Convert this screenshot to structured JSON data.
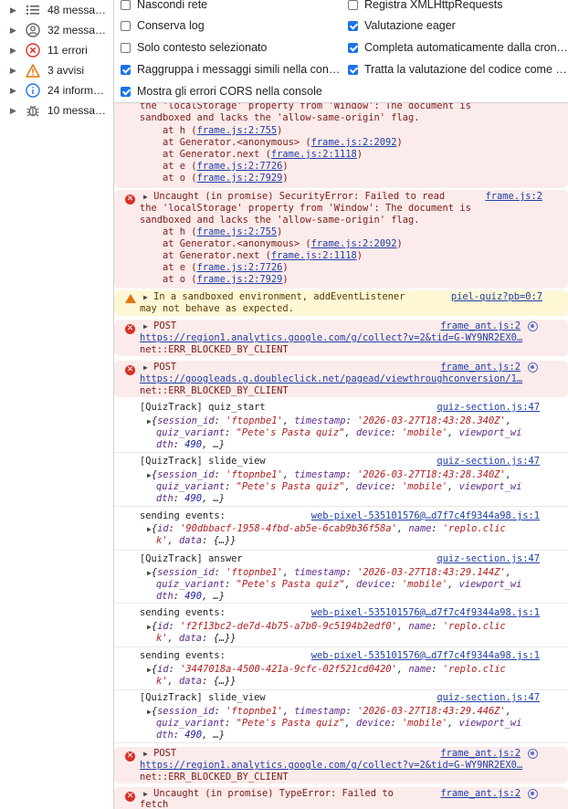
{
  "sidebar": {
    "items": [
      {
        "label": "48 messa…",
        "icon": "list-icon"
      },
      {
        "label": "32 messa…",
        "icon": "user-circle-icon"
      },
      {
        "label": "11 errori",
        "icon": "error-circle-icon"
      },
      {
        "label": "3 avvisi",
        "icon": "warning-triangle-icon"
      },
      {
        "label": "24 inform…",
        "icon": "info-circle-icon"
      },
      {
        "label": "10 messa…",
        "icon": "bug-icon"
      }
    ]
  },
  "settings": {
    "left": [
      {
        "label": "Nascondi rete",
        "checked": false
      },
      {
        "label": "Conserva log",
        "checked": false
      },
      {
        "label": "Solo contesto selezionato",
        "checked": false
      },
      {
        "label": "Raggruppa i messaggi simili nella con…",
        "checked": true
      },
      {
        "label": "Mostra gli errori CORS nella console",
        "checked": true
      }
    ],
    "right": [
      {
        "label": "Registra XMLHttpRequests",
        "checked": false
      },
      {
        "label": "Valutazione eager",
        "checked": true
      },
      {
        "label": "Completa automaticamente dalla cron…",
        "checked": true
      },
      {
        "label": "Tratta la valutazione del codice come …",
        "checked": true
      }
    ]
  },
  "console": {
    "e1": {
      "l1": "the 'localStorage' property from 'Window': The document is",
      "l2": "sandboxed and lacks the 'allow-same-origin' flag.",
      "stack": [
        {
          "pre": "    at h (",
          "link": "frame.js:2:755",
          "post": ")"
        },
        {
          "pre": "    at Generator.<anonymous> (",
          "link": "frame.js:2:2092",
          "post": ")"
        },
        {
          "pre": "    at Generator.next (",
          "link": "frame.js:2:1118",
          "post": ")"
        },
        {
          "pre": "    at e (",
          "link": "frame.js:2:7726",
          "post": ")"
        },
        {
          "pre": "    at o (",
          "link": "frame.js:2:7929",
          "post": ")"
        }
      ]
    },
    "e2": {
      "head": "Uncaught (in promise) SecurityError: Failed to read",
      "source": "frame.js:2",
      "l1": "the 'localStorage' property from 'Window': The document is",
      "l2": "sandboxed and lacks the 'allow-same-origin' flag.",
      "stack": [
        {
          "pre": "    at h (",
          "link": "frame.js:2:755",
          "post": ")"
        },
        {
          "pre": "    at Generator.<anonymous> (",
          "link": "frame.js:2:2092",
          "post": ")"
        },
        {
          "pre": "    at Generator.next (",
          "link": "frame.js:2:1118",
          "post": ")"
        },
        {
          "pre": "    at e (",
          "link": "frame.js:2:7726",
          "post": ")"
        },
        {
          "pre": "    at o (",
          "link": "frame.js:2:7929",
          "post": ")"
        }
      ]
    },
    "w1": {
      "head": "In a sandboxed environment, addEventListener",
      "source": "piel-quiz?pb=0:7",
      "l2": "may not behave as expected."
    },
    "p1": {
      "head": "POST",
      "source": "frame_ant.js:2",
      "url": "https://region1.analytics.google.com/g/collect?v=2&tid=G-WY9NR2EX0…",
      "err": "net::ERR_BLOCKED_BY_CLIENT"
    },
    "p2": {
      "head": "POST",
      "source": "frame_ant.js:2",
      "url": "https://googleads.g.doubleclick.net/pagead/viewthroughconversion/1…",
      "err": "net::ERR_BLOCKED_BY_CLIENT"
    },
    "q1": {
      "head": "[QuizTrack] quiz_start",
      "source": "quiz-section.js:47",
      "sid": "'ftopnbe1'",
      "ts": "'2026-03-27T18:43:28.340Z'",
      "variant": "\"Pete's Pasta quiz\"",
      "device": "'mobile'",
      "vw_a": "viewport_wi",
      "vw_b": "dth",
      "w": "490"
    },
    "q2": {
      "head": "[QuizTrack] slide_view",
      "source": "quiz-section.js:47",
      "sid": "'ftopnbe1'",
      "ts": "'2026-03-27T18:43:28.340Z'",
      "variant": "\"Pete's Pasta quiz\"",
      "device": "'mobile'",
      "vw_a": "viewport_wi",
      "vw_b": "dth",
      "w": "490"
    },
    "s1": {
      "head": "sending events:",
      "source": "web-pixel-535101576@…d7f7c4f9344a98.js:1",
      "id": "'90dbbacf-1958-4fbd-ab5e-6cab9b36f58a'",
      "name_a": "'replo.clic",
      "name_b": "k'"
    },
    "q3": {
      "head": "[QuizTrack] answer",
      "source": "quiz-section.js:47",
      "sid": "'ftopnbe1'",
      "ts": "'2026-03-27T18:43:29.144Z'",
      "variant": "\"Pete's Pasta quiz\"",
      "device": "'mobile'",
      "vw_a": "viewport_wi",
      "vw_b": "dth",
      "w": "490"
    },
    "s2": {
      "head": "sending events:",
      "source": "web-pixel-535101576@…d7f7c4f9344a98.js:1",
      "id": "'f2f13bc2-de7d-4b75-a7b0-9c5194b2edf0'",
      "name_a": "'replo.clic",
      "name_b": "k'"
    },
    "s3": {
      "head": "sending events:",
      "source": "web-pixel-535101576@…d7f7c4f9344a98.js:1",
      "id": "'3447018a-4500-421a-9cfc-02f521cd0420'",
      "name_a": "'replo.clic",
      "name_b": "k'"
    },
    "q4": {
      "head": "[QuizTrack] slide_view",
      "source": "quiz-section.js:47",
      "sid": "'ftopnbe1'",
      "ts": "'2026-03-27T18:43:29.446Z'",
      "variant": "\"Pete's Pasta quiz\"",
      "device": "'mobile'",
      "vw_a": "viewport_wi",
      "vw_b": "dth",
      "w": "490"
    },
    "p3": {
      "head": "POST",
      "source": "frame_ant.js:2",
      "url": "https://region1.analytics.google.com/g/collect?v=2&tid=G-WY9NR2EX0…",
      "err": "net::ERR_BLOCKED_BY_CLIENT"
    },
    "e3": {
      "head": "Uncaught (in promise) TypeError: Failed to",
      "source": "frame_ant.js:2",
      "l2": "fetch"
    },
    "tokens": {
      "session_id": "session_id",
      "timestamp": "timestamp",
      "quiz_variant": "quiz_variant",
      "device": "device",
      "id": "id",
      "name": "name",
      "data": "data",
      "ellipsis_obj": "{…}",
      "ellipsis": "…}"
    }
  }
}
